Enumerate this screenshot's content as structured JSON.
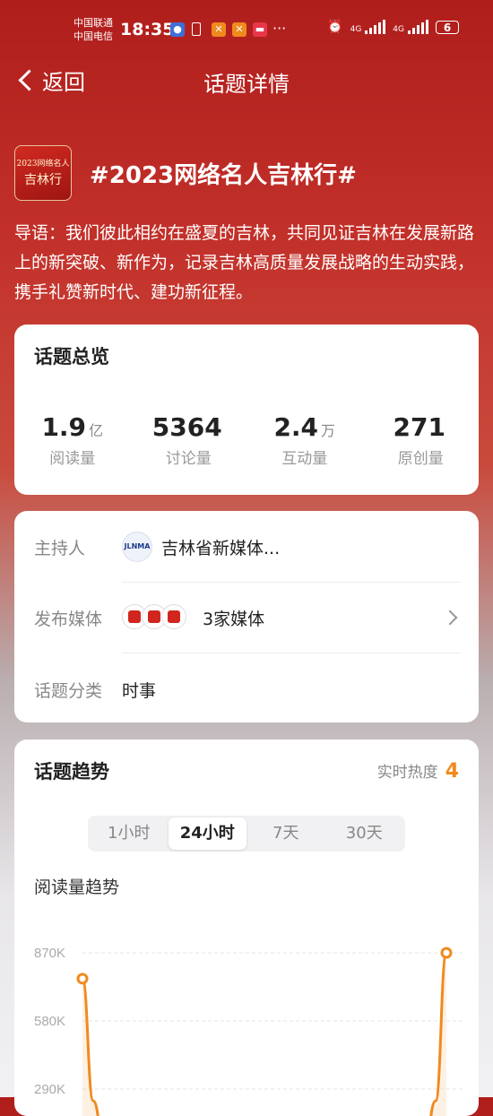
{
  "status": {
    "carrier1": "中国联通",
    "carrier2": "中国电信",
    "time": "18:35",
    "more": "···",
    "net1": "4G",
    "net2": "4G",
    "battery": "6"
  },
  "nav": {
    "back_label": "返回",
    "title": "话题详情"
  },
  "topic": {
    "thumb_line1": "2023网络名人",
    "thumb_line2": "吉林行",
    "title": "#2023网络名人吉林行#",
    "intro": "导语：我们彼此相约在盛夏的吉林，共同见证吉林在发展新路上的新突破、新作为，记录吉林高质量发展战略的生动实践，携手礼赞新时代、建功新征程。"
  },
  "overview": {
    "title": "话题总览",
    "stats": [
      {
        "value": "1.9",
        "unit": "亿",
        "label": "阅读量"
      },
      {
        "value": "5364",
        "unit": "",
        "label": "讨论量"
      },
      {
        "value": "2.4",
        "unit": "万",
        "label": "互动量"
      },
      {
        "value": "271",
        "unit": "",
        "label": "原创量"
      }
    ]
  },
  "info": {
    "host_label": "主持人",
    "host_logo_text": "JLNMA",
    "host_value": "吉林省新媒体...",
    "media_label": "发布媒体",
    "media_value": "3家媒体",
    "category_label": "话题分类",
    "category_value": "时事"
  },
  "trend": {
    "title": "话题趋势",
    "heat_label": "实时热度",
    "heat_value": "4",
    "tabs": [
      "1小时",
      "24小时",
      "7天",
      "30天"
    ],
    "active_tab": "24小时",
    "chart_title": "阅读量趋势"
  },
  "colors": {
    "accent": "#f08a1e",
    "brand_red": "#c2302a"
  },
  "chart_data": {
    "type": "line",
    "title": "阅读量趋势",
    "xlabel": "",
    "ylabel": "",
    "y_tick_labels": [
      "870K",
      "580K",
      "290K"
    ],
    "y_ticks": [
      870000,
      580000,
      290000
    ],
    "ylim": [
      0,
      870000
    ],
    "series": [
      {
        "values": [
          760000,
          240000,
          0,
          0,
          0,
          0,
          0,
          0,
          0,
          0,
          0,
          240000,
          870000
        ]
      }
    ],
    "grid": true
  }
}
